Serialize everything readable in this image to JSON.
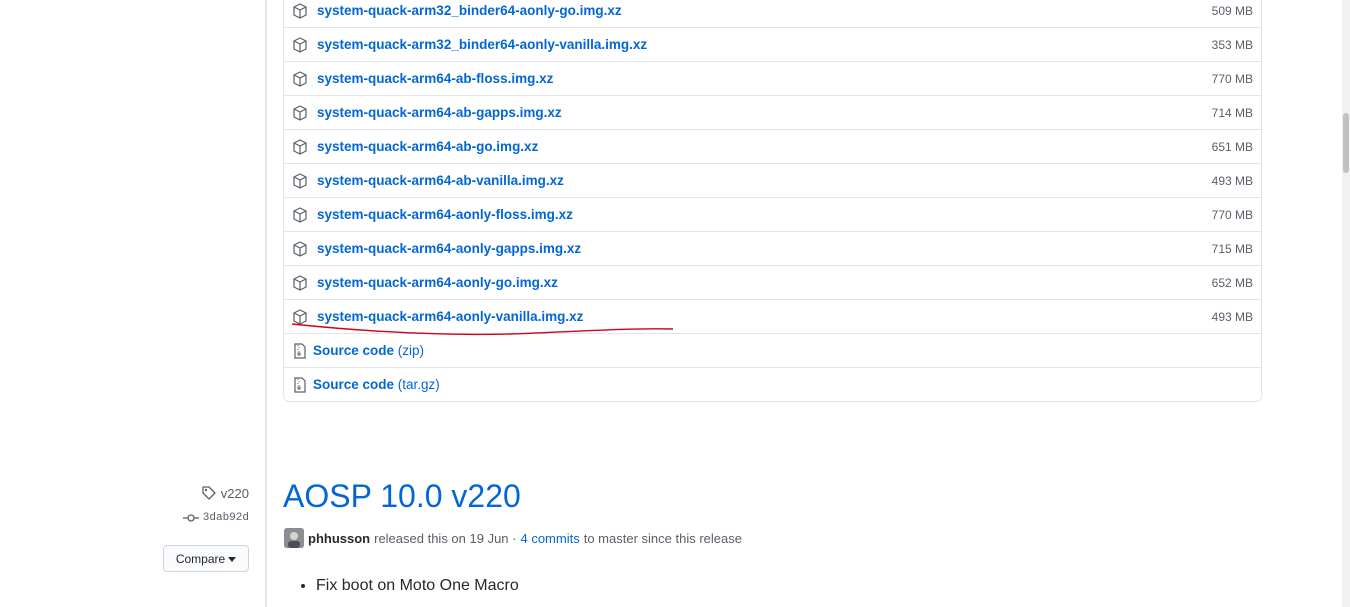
{
  "assets": [
    {
      "name": "system-quack-arm32_binder64-aonly-go.img.xz",
      "size": "509 MB"
    },
    {
      "name": "system-quack-arm32_binder64-aonly-vanilla.img.xz",
      "size": "353 MB"
    },
    {
      "name": "system-quack-arm64-ab-floss.img.xz",
      "size": "770 MB"
    },
    {
      "name": "system-quack-arm64-ab-gapps.img.xz",
      "size": "714 MB"
    },
    {
      "name": "system-quack-arm64-ab-go.img.xz",
      "size": "651 MB"
    },
    {
      "name": "system-quack-arm64-ab-vanilla.img.xz",
      "size": "493 MB"
    },
    {
      "name": "system-quack-arm64-aonly-floss.img.xz",
      "size": "770 MB"
    },
    {
      "name": "system-quack-arm64-aonly-gapps.img.xz",
      "size": "715 MB"
    },
    {
      "name": "system-quack-arm64-aonly-go.img.xz",
      "size": "652 MB"
    },
    {
      "name": "system-quack-arm64-aonly-vanilla.img.xz",
      "size": "493 MB"
    }
  ],
  "source_code": [
    {
      "label": "Source code",
      "suffix": "(zip)"
    },
    {
      "label": "Source code",
      "suffix": "(tar.gz)"
    }
  ],
  "sidebar": {
    "tag": "v220",
    "commit": "3dab92d",
    "compare_label": "Compare"
  },
  "release": {
    "title": "AOSP 10.0 v220",
    "author": "phhusson",
    "released_text": "released this on 19 Jun ·",
    "commits_link": "4 commits",
    "since_text": "to master since this release",
    "notes": [
      "Fix boot on Moto One Macro"
    ]
  },
  "colors": {
    "link": "#0366d6",
    "annotation": "#d0021b",
    "border": "#e1e4e8"
  },
  "icons": {
    "asset": "package-icon",
    "source": "file-zip-icon",
    "tag": "tag-icon",
    "commit": "git-commit-icon",
    "dropdown": "triangle-down-icon"
  }
}
